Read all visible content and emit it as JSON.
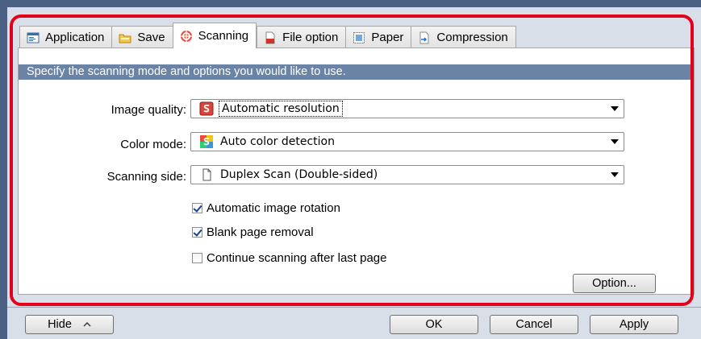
{
  "tabs": [
    {
      "label": "Application",
      "icon": "application-icon",
      "active": false
    },
    {
      "label": "Save",
      "icon": "folder-icon",
      "active": false
    },
    {
      "label": "Scanning",
      "icon": "scanning-icon",
      "active": true
    },
    {
      "label": "File option",
      "icon": "file-option-icon",
      "active": false
    },
    {
      "label": "Paper",
      "icon": "paper-icon",
      "active": false
    },
    {
      "label": "Compression",
      "icon": "compression-icon",
      "active": false
    }
  ],
  "banner": "Specify the scanning mode and options you would like to use.",
  "fields": {
    "image_quality": {
      "label": "Image quality:",
      "value": "Automatic resolution",
      "icon": "resolution-icon"
    },
    "color_mode": {
      "label": "Color mode:",
      "value": "Auto color detection",
      "icon": "color-mode-icon"
    },
    "scanning_side": {
      "label": "Scanning side:",
      "value": "Duplex Scan (Double-sided)",
      "icon": "duplex-icon"
    }
  },
  "checkboxes": {
    "rotation": {
      "label": "Automatic image rotation",
      "checked": true
    },
    "blank": {
      "label": "Blank page removal",
      "checked": true
    },
    "continue": {
      "label": "Continue scanning after last page",
      "checked": false
    }
  },
  "buttons": {
    "option": "Option...",
    "hide": "Hide",
    "ok": "OK",
    "cancel": "Cancel",
    "apply": "Apply"
  },
  "colors": {
    "frame": "#4a6184",
    "banner": "#6b83a4",
    "highlight": "#e3001b"
  }
}
